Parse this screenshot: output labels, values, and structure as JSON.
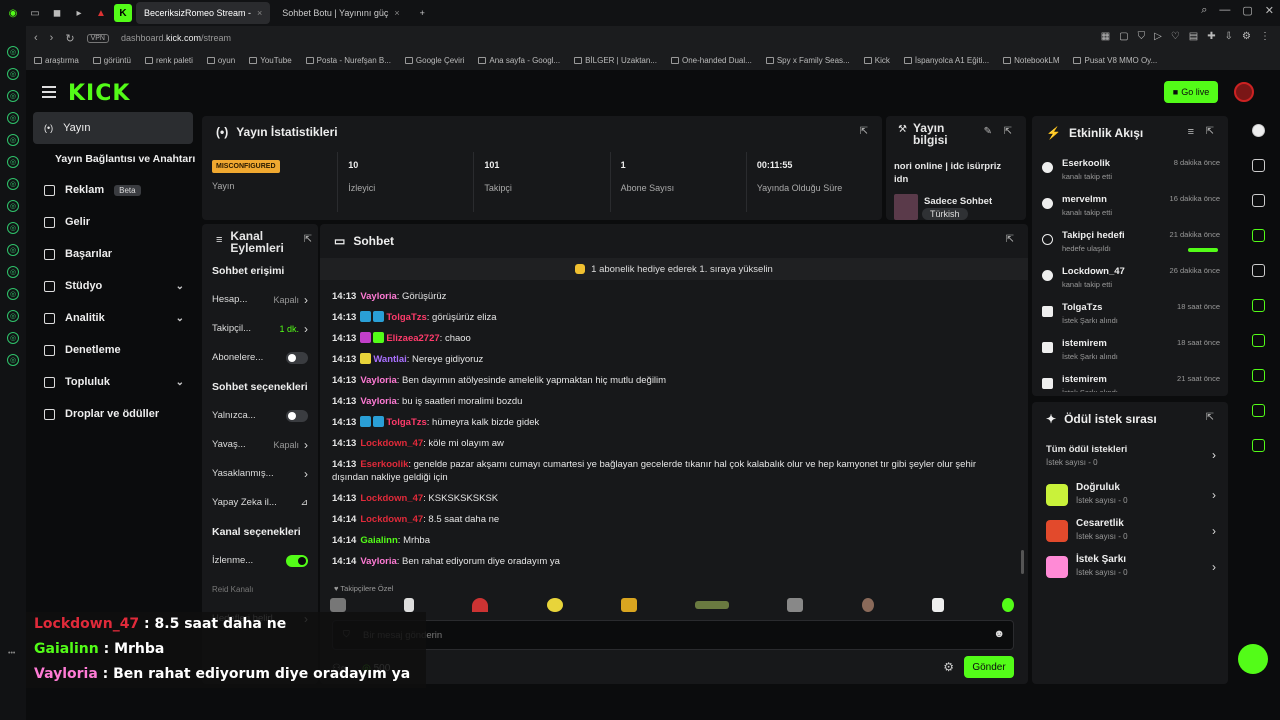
{
  "browser": {
    "tabs": [
      {
        "label": "BeceriksizRomeo Stream -",
        "active": true
      },
      {
        "label": "Sohbet Botu | Yayınını güç",
        "active": false
      }
    ],
    "url_prefix": "dashboard.",
    "url_domain": "kick.com",
    "url_path": "/stream",
    "vpn_label": "VPN",
    "bookmarks": [
      "araştırma",
      "görüntü",
      "renk paleti",
      "oyun",
      "YouTube",
      "Posta - Nurefşan B...",
      "Google Çeviri",
      "Ana sayfa - Googl...",
      "BİLGER | Uzaktan...",
      "One-handed Dual...",
      "Spy x Family Seas...",
      "Kick",
      "İspanyolca A1 Eğiti...",
      "NotebookLM",
      "Pusat V8 MMO Oy..."
    ]
  },
  "topbar": {
    "logo": "KICK",
    "go_live": "Go live"
  },
  "sidebar": {
    "items": [
      {
        "label": "Yayın",
        "active": true
      },
      {
        "label": "Yayın Bağlantısı ve Anahtarı",
        "sub": true
      },
      {
        "label": "Reklam",
        "badge": "Beta"
      },
      {
        "label": "Gelir"
      },
      {
        "label": "Başarılar"
      },
      {
        "label": "Stüdyo",
        "chevron": true
      },
      {
        "label": "Analitik",
        "chevron": true
      },
      {
        "label": "Denetleme"
      },
      {
        "label": "Topluluk",
        "chevron": true
      },
      {
        "label": "Droplar ve ödüller"
      }
    ]
  },
  "stats": {
    "title": "Yayın İstatistikleri",
    "items": [
      {
        "value": "MISCONFIGURED",
        "label": "Yayın"
      },
      {
        "value": "10",
        "label": "İzleyici"
      },
      {
        "value": "101",
        "label": "Takipçi"
      },
      {
        "value": "1",
        "label": "Abone Sayısı"
      },
      {
        "value": "00:11:55",
        "label": "Yayında Olduğu Süre"
      }
    ]
  },
  "stream_info": {
    "title": "Yayın bilgisi",
    "stream_title": "nori online | idc isürpriz idn",
    "category": "Sadece Sohbet",
    "tag": "Türkish"
  },
  "channel_actions": {
    "title": "Kanal Eylemleri",
    "sec1": "Sohbet erişimi",
    "rows1": [
      {
        "label": "Hesap...",
        "value": "Kapalı",
        "control": "chevron"
      },
      {
        "label": "Takipçil...",
        "value": "1 dk.",
        "control": "chevron",
        "green": true
      },
      {
        "label": "Abonelere...",
        "control": "toggle",
        "on": false
      }
    ],
    "sec2": "Sohbet seçenekleri",
    "rows2": [
      {
        "label": "Yalnızca...",
        "control": "toggle",
        "on": false
      },
      {
        "label": "Yavaş...",
        "value": "Kapalı",
        "control": "chevron"
      },
      {
        "label": "Yasaklanmış...",
        "control": "chevron"
      },
      {
        "label": "Yapay Zeka il...",
        "control": "chart"
      }
    ],
    "sec3": "Kanal seçenekleri",
    "rows3": [
      {
        "label": "İzlenme...",
        "control": "toggle",
        "on": true
      },
      {
        "label": "Reid Kanalı",
        "control": "none"
      },
      {
        "label": "Hedefleri belirl...",
        "control": "chevron"
      }
    ]
  },
  "chat": {
    "title": "Sohbet",
    "pinned": "1 abonelik hediye ederek 1. sıraya yükselin",
    "messages": [
      {
        "time": "14:13",
        "user": "Vayloria",
        "color": "#ff7bd5",
        "badges": [],
        "text": ": Görüşürüz"
      },
      {
        "time": "14:13",
        "user": "TolgaTzs",
        "color": "#ff3b6b",
        "badges": [
          "#2a9fd6",
          "#2a9fd6"
        ],
        "text": ": görüşürüz eliza"
      },
      {
        "time": "14:13",
        "user": "Elizaea2727",
        "color": "#ff3b6b",
        "badges": [
          "#c23fc9",
          "#53fc18"
        ],
        "text": ": chaoo"
      },
      {
        "time": "14:13",
        "user": "Wantlai",
        "color": "#a970ff",
        "badges": [
          "#e8d43a"
        ],
        "text": ": Nereye gidiyoruz"
      },
      {
        "time": "14:13",
        "user": "Vayloria",
        "color": "#ff7bd5",
        "badges": [],
        "text": ": Ben dayımın atölyesinde amelelik yapmaktan hiç mutlu değilim"
      },
      {
        "time": "14:13",
        "user": "Vayloria",
        "color": "#ff7bd5",
        "badges": [],
        "text": ": bu iş saatleri moralimi bozdu"
      },
      {
        "time": "14:13",
        "user": "TolgaTzs",
        "color": "#ff3b6b",
        "badges": [
          "#2a9fd6",
          "#2a9fd6"
        ],
        "text": ": hümeyra kalk bizde gidek"
      },
      {
        "time": "14:13",
        "user": "Lockdown_47",
        "color": "#e02a3a",
        "badges": [],
        "text": ": köle mi olayım aw"
      },
      {
        "time": "14:13",
        "user": "Eserkoolik",
        "color": "#e02a3a",
        "badges": [],
        "text": ": genelde pazar akşamı cumayı cumartesi ye bağlayan gecelerde tıkanır hal çok kalabalık olur ve hep kamyonet tır gibi şeyler olur şehir dışından nakliye geldiği için"
      },
      {
        "time": "14:13",
        "user": "Lockdown_47",
        "color": "#e02a3a",
        "badges": [],
        "text": ": KSKSKSKSKSK"
      },
      {
        "time": "14:14",
        "user": "Lockdown_47",
        "color": "#e02a3a",
        "badges": [],
        "text": ": 8.5 saat daha ne"
      },
      {
        "time": "14:14",
        "user": "Gaialinn",
        "color": "#53fc18",
        "badges": [],
        "text": ": Mrhba"
      },
      {
        "time": "14:14",
        "user": "Vayloria",
        "color": "#ff7bd5",
        "badges": [],
        "text": ": Ben rahat ediyorum diye oradayım ya"
      }
    ],
    "followers_only": "Takipçilere Özel",
    "input_placeholder": "Bir mesaj gönderin",
    "points": "500",
    "send": "Gönder"
  },
  "events": {
    "title": "Etkinlik Akışı",
    "items": [
      {
        "name": "Eserkoolik",
        "sub": "kanalı takip etti",
        "time": "8 dakika önce"
      },
      {
        "name": "mervelmn",
        "sub": "kanalı takip etti",
        "time": "16 dakika önce"
      },
      {
        "name": "Takipçi hedefi",
        "sub": "hedefe ulaşıldı",
        "time": "21 dakika önce",
        "progress": 1.0
      },
      {
        "name": "Lockdown_47",
        "sub": "kanalı takip etti",
        "time": "26 dakika önce"
      },
      {
        "name": "TolgaTzs",
        "sub": "İstek Şarkı alındı",
        "time": "18 saat önce"
      },
      {
        "name": "istemirem",
        "sub": "İstek Şarkı alındı",
        "time": "18 saat önce"
      },
      {
        "name": "istemirem",
        "sub": "İstek Şarkı alındı",
        "time": "21 saat önce"
      }
    ]
  },
  "rewards": {
    "title": "Ödül istek sırası",
    "all_label": "Tüm ödül istekleri",
    "all_sub": "İstek sayısı - 0",
    "items": [
      {
        "name": "Doğruluk",
        "sub": "İstek sayısı - 0",
        "color": "#c9f23a"
      },
      {
        "name": "Cesaretlik",
        "sub": "İstek sayısı - 0",
        "color": "#e24a2c"
      },
      {
        "name": "İstek Şarkı",
        "sub": "İstek sayısı - 0",
        "color": "#ff8ad6"
      }
    ]
  },
  "overlay": {
    "lines": [
      {
        "user": "Lockdown_47",
        "color": "#e02a3a",
        "text": " : 8.5 saat daha ne"
      },
      {
        "user": "Gaialinn",
        "color": "#53fc18",
        "text": " : Mrhba"
      },
      {
        "user": "Vayloria",
        "color": "#ff7bd5",
        "text": " : Ben rahat ediyorum diye oradayım ya"
      }
    ]
  }
}
